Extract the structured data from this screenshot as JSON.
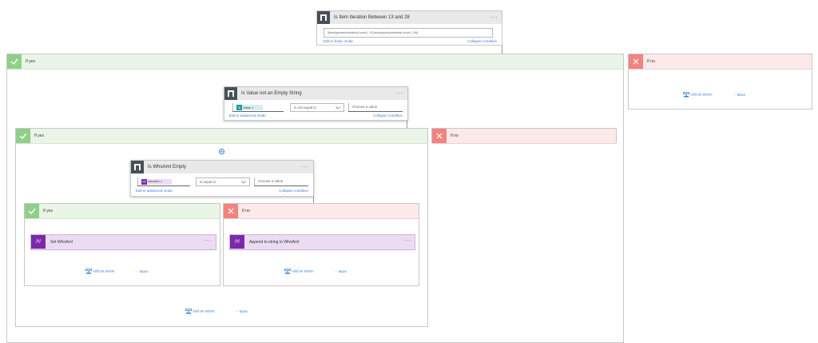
{
  "top_condition": {
    "title": "Is Item Iteration Between 13 and 28",
    "expression": "@and(greater(variables('count'), 13),less(equals(variables('count'), 28))",
    "edit_mode": "Edit in basic mode",
    "collapse": "Collapse condition"
  },
  "outer_yes": {
    "label": "If yes"
  },
  "outer_no": {
    "label": "If no",
    "add_action": "Add an action",
    "more": "More"
  },
  "value_condition": {
    "title": "Is Value not an Empty String",
    "token": "Value",
    "operator": "is not equal to",
    "value_placeholder": "Choose a value",
    "edit_mode": "Edit in advanced mode",
    "collapse": "Collapse condition"
  },
  "mid_yes": {
    "label": "If yes",
    "add_action": "Add an action",
    "more": "More"
  },
  "mid_no": {
    "label": "If no"
  },
  "whoami_condition": {
    "title": "Is WhoAmI Empty",
    "token": "whoAmI",
    "operator": "is equal to",
    "value_placeholder": "Choose a value",
    "edit_mode": "Edit in advanced mode",
    "collapse": "Collapse condition"
  },
  "inner_yes": {
    "label": "If yes",
    "action_title": "Set WhoAmI",
    "add_action": "Add an action",
    "more": "More"
  },
  "inner_no": {
    "label": "If no",
    "action_title": "Append to string to WhoAmI",
    "add_action": "Add an action",
    "more": "More"
  },
  "icons": {
    "condition": "condition-icon",
    "variable": "variable-icon",
    "check": "check-icon",
    "close": "close-icon",
    "add_action": "add-action-icon",
    "insert": "plus-circle-icon"
  },
  "colors": {
    "yes_bar": "#e9f5e6",
    "yes_icon": "#8ed089",
    "no_bar": "#fde9e9",
    "no_icon": "#f2837f",
    "condition_icon": "#484f58",
    "variable_icon": "#7a2aa8",
    "value_token": "#1e9aa8",
    "whoami_token": "#7a2aa8",
    "link": "#3a7ed8"
  }
}
